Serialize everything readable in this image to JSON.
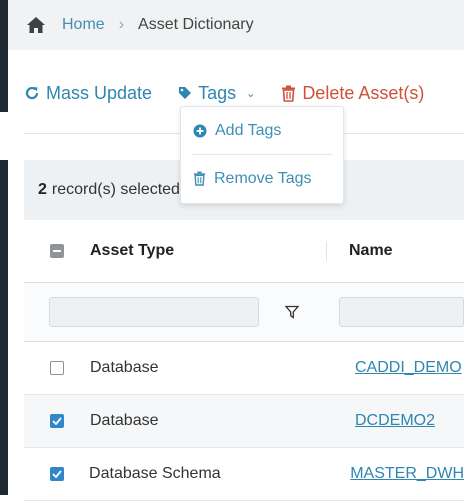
{
  "breadcrumb": {
    "home": "Home",
    "current": "Asset Dictionary"
  },
  "toolbar": {
    "mass_update": "Mass Update",
    "tags": "Tags",
    "delete": "Delete Asset(s)"
  },
  "tags_menu": {
    "add": "Add Tags",
    "remove": "Remove Tags"
  },
  "records": {
    "count": "2",
    "text": "record(s) selected"
  },
  "table": {
    "columns": [
      "Asset Type",
      "Name"
    ],
    "rows": [
      {
        "checked": false,
        "asset_type": "Database",
        "name": "CADDI_DEMO"
      },
      {
        "checked": true,
        "asset_type": "Database",
        "name": "DCDEMO2"
      },
      {
        "checked": true,
        "asset_type": "Database Schema",
        "name": "MASTER_DWH"
      }
    ]
  },
  "colors": {
    "accent": "#2f86b1",
    "danger": "#d0503a",
    "checkbox": "#2f86c9"
  },
  "icons": [
    "home-icon",
    "refresh-icon",
    "tag-icon",
    "chevron-down-icon",
    "trash-icon",
    "plus-circle-icon",
    "filter-icon"
  ]
}
